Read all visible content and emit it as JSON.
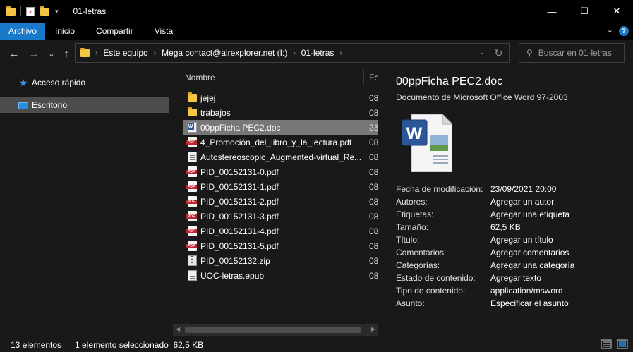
{
  "window": {
    "title": "01-letras",
    "minimize": "—",
    "maximize": "☐",
    "close": "✕"
  },
  "ribbon": {
    "tabs": [
      "Archivo",
      "Inicio",
      "Compartir",
      "Vista"
    ],
    "help": "?"
  },
  "nav": {
    "back": "←",
    "forward": "→",
    "recent": "⌄",
    "up": "↑",
    "breadcrumb": [
      "Este equipo",
      "Mega contact@airexplorer.net (I:)",
      "01-letras"
    ],
    "search_placeholder": "Buscar en 01-letras"
  },
  "sidebar": {
    "items": [
      {
        "label": "Acceso rápido",
        "icon": "star-icon"
      },
      {
        "label": "Escritorio",
        "icon": "desktop-icon"
      }
    ]
  },
  "filelist": {
    "columns": {
      "name": "Nombre",
      "date": "Fe"
    },
    "files": [
      {
        "name": "jejej",
        "type": "folder",
        "date": "08"
      },
      {
        "name": "trabajos",
        "type": "folder",
        "date": "08"
      },
      {
        "name": "00ppFicha PEC2.doc",
        "type": "doc",
        "date": "23"
      },
      {
        "name": "4_Promoción_del_libro_y_la_lectura.pdf",
        "type": "pdf",
        "date": "08"
      },
      {
        "name": "Autostereoscopic_Augmented-virtual_Re...",
        "type": "epub",
        "date": "08"
      },
      {
        "name": "PID_00152131-0.pdf",
        "type": "pdf",
        "date": "08"
      },
      {
        "name": "PID_00152131-1.pdf",
        "type": "pdf",
        "date": "08"
      },
      {
        "name": "PID_00152131-2.pdf",
        "type": "pdf",
        "date": "08"
      },
      {
        "name": "PID_00152131-3.pdf",
        "type": "pdf",
        "date": "08"
      },
      {
        "name": "PID_00152131-4.pdf",
        "type": "pdf",
        "date": "08"
      },
      {
        "name": "PID_00152131-5.pdf",
        "type": "pdf",
        "date": "08"
      },
      {
        "name": "PID_00152132.zip",
        "type": "zip",
        "date": "08"
      },
      {
        "name": "UOC-letras.epub",
        "type": "epub",
        "date": "08"
      }
    ]
  },
  "details": {
    "title": "00ppFicha PEC2.doc",
    "type": "Documento de Microsoft Office Word 97-2003",
    "properties": [
      {
        "label": "Fecha de modificación:",
        "value": "23/09/2021 20:00"
      },
      {
        "label": "Autores:",
        "value": "Agregar un autor"
      },
      {
        "label": "Etiquetas:",
        "value": "Agregar una etiqueta"
      },
      {
        "label": "Tamaño:",
        "value": "62,5 KB"
      },
      {
        "label": "Título:",
        "value": "Agregar un título"
      },
      {
        "label": "Comentarios:",
        "value": "Agregar comentarios"
      },
      {
        "label": "Categorías:",
        "value": "Agregar una categoría"
      },
      {
        "label": "Estado de contenido:",
        "value": "Agregar texto"
      },
      {
        "label": "Tipo de contenido:",
        "value": "application/msword"
      },
      {
        "label": "Asunto:",
        "value": "Especificar el asunto"
      }
    ]
  },
  "status": {
    "count": "13 elementos",
    "selection": "1 elemento seleccionado  62,5 KB"
  }
}
